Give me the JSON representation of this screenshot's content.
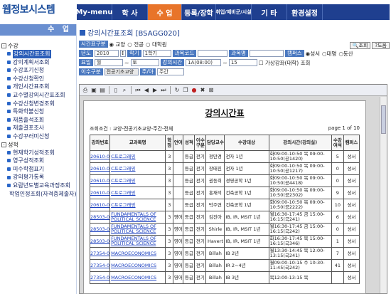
{
  "app": {
    "logo": "웹정보시스템"
  },
  "menu": [
    {
      "label": "My-menu",
      "w": 50
    },
    {
      "label": "학 사",
      "w": 50
    },
    {
      "label": "수 업",
      "w": 48,
      "active": true
    },
    {
      "label": "등록/장학",
      "w": 48
    },
    {
      "label": "취업/제비군/시설",
      "w": 50,
      "small": true
    },
    {
      "label": "기 타",
      "w": 50
    },
    {
      "label": "환경설정",
      "w": 50
    }
  ],
  "left": {
    "header": "수 업",
    "groups": [
      {
        "label": "수강",
        "items": [
          "강의시간표조회",
          "강의계획서조회",
          "수강포기신청",
          "수강신청확인",
          "개인시간표조회",
          "교수별강의시간표조회",
          "수강신청변경조회",
          "특화학불신청",
          "재품출석조회",
          "재출결포조사",
          "수강꾸러미신청"
        ],
        "selected": 0
      },
      {
        "label": "성적",
        "items": [
          "현재학기성적조회",
          "영구성적조회",
          "미수학점표기",
          "강의평가통록",
          "요람년도별교육과정조회",
          "학업인정조회(자격증제출자)"
        ]
      }
    ]
  },
  "page": {
    "title": "강의시간표조회 [BSAGG020]",
    "buttons": {
      "search": "조회",
      "help": "도움"
    }
  },
  "filter": {
    "type_label": "시간표구분",
    "options": [
      "교양",
      "전공",
      "대학원"
    ],
    "year_label": "년도",
    "year": "2010",
    "term_label": "학기",
    "term": "1학기",
    "course_label": "과목코드",
    "coursename_label": "과목명",
    "campus_label": "캠퍼스",
    "campus_opts": [
      "성서",
      "대명",
      "동산"
    ],
    "day_label": "요일",
    "day": "월",
    "day_to": "토",
    "time_label": "강의시간",
    "time_from": "1A(08:00)",
    "time_to": "15",
    "check_label": "가상강좌(대학) 조회",
    "track_label": "이수구분",
    "track": "전공기초교양",
    "period_label": "주/야",
    "period": "주간"
  },
  "report": {
    "title": "강의시간표",
    "condition": "조회조건 : 교양-전공기초교양-주간-전체",
    "page": "page 1 of 10",
    "headers": [
      "강좌번호",
      "교과목명",
      "학점",
      "언어",
      "성적",
      "이수구분",
      "담당교수",
      "수강대상",
      "강의시간(강의실)",
      "수강여석",
      "캠퍼스"
    ],
    "rows": [
      [
        "20610-01",
        "C프로그래밍",
        "3",
        "",
        "등급",
        "전기",
        "정만경",
        "전자 1년",
        "화09:00-10:50 목 09:00-10:50(공1420)",
        "5",
        "성서"
      ],
      [
        "20610-02",
        "C프로그래밍",
        "3",
        "",
        "등급",
        "전기",
        "장태진",
        "전자 1년",
        "화09:00-10:50 목 09:00-10:50(공1217)",
        "0",
        "성서"
      ],
      [
        "20610-03",
        "C프로그래밍",
        "3",
        "",
        "등급",
        "전기",
        "권동희",
        "경영공학 1년",
        "화09:00-10:50 목 09:00-10:50(공4418)",
        "0",
        "성서"
      ],
      [
        "20610-04",
        "C프로그래밍",
        "3",
        "",
        "등급",
        "전기",
        "홍재석",
        "건축공학 1년",
        "화09:00-10:50 목 09:00-10:50(공2302)",
        "9",
        "성서"
      ],
      [
        "20610-05",
        "C프로그래밍",
        "3",
        "",
        "등급",
        "전기",
        "박주연",
        "건축공학 1년",
        "화09:00-10:50 목 09:00-10:50(공2222)",
        "10",
        "성서"
      ],
      [
        "28503-01",
        "FUNDAMENTALS OF POLITICAL SCIENCE",
        "3",
        "영어",
        "등급",
        "전기",
        "김진아",
        "IB, IR, MSIT 1년",
        "월16:30-17:45 금 15:00-16:15(국241)",
        "6",
        "성서"
      ],
      [
        "28503-02",
        "FUNDAMENTALS OF POLITICAL SCIENCE",
        "3",
        "영어",
        "등급",
        "전기",
        "Shirle",
        "IB, IR, MSIT 1년",
        "월16:30-17:45 금 15:00-16:15(국242)",
        "0",
        "성서"
      ],
      [
        "28503-03",
        "FUNDAMENTALS OF POLITICAL SCIENCE",
        "3",
        "영어",
        "등급",
        "전기",
        "Havert",
        "IB, IR, MSIT 1년",
        "화16:30-17:45 목 15:00-16:15(국346)",
        "1",
        "성서"
      ],
      [
        "27354-01",
        "MACROECONOMICS",
        "3",
        "영어",
        "등급",
        "전기",
        "Billah",
        "IB 2년",
        "월13:30-14:45 목 12:00-13:15(국241)",
        "7",
        "성서"
      ],
      [
        "27354-02",
        "MACROECONOMICS",
        "3",
        "영어",
        "등급",
        "전기",
        "Billah",
        "IR 2~4년",
        "월09:00-10:15 수 10:30-11:45(국242)",
        "41",
        "성서"
      ],
      [
        "27354-03",
        "MACROECONOMICS",
        "3",
        "영어",
        "등급",
        "전기",
        "Billah",
        "IB 3년",
        "목12:00-13:15 목",
        "",
        "성서"
      ]
    ]
  }
}
